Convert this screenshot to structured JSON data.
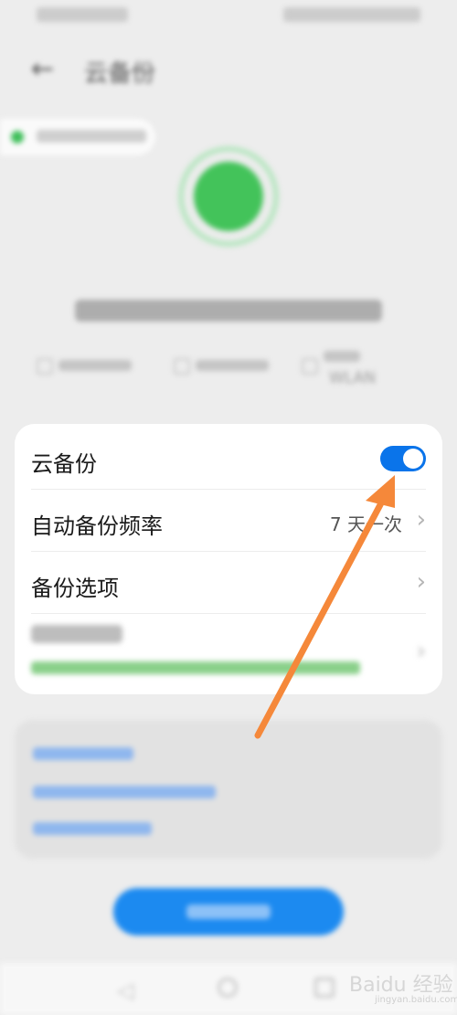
{
  "header": {
    "title": "云备份"
  },
  "conditions": {
    "wlan_label": "WLAN"
  },
  "settings": {
    "cloud_backup": {
      "label": "云备份",
      "enabled": true
    },
    "auto_frequency": {
      "label": "自动备份频率",
      "value": "7 天一次"
    },
    "backup_options": {
      "label": "备份选项"
    }
  },
  "watermark": {
    "text": "Baidu 经验",
    "url": "jingyan.baidu.com"
  },
  "colors": {
    "accent": "#0a74ea",
    "success": "#43c35a",
    "annotation_arrow": "#f5883a"
  }
}
